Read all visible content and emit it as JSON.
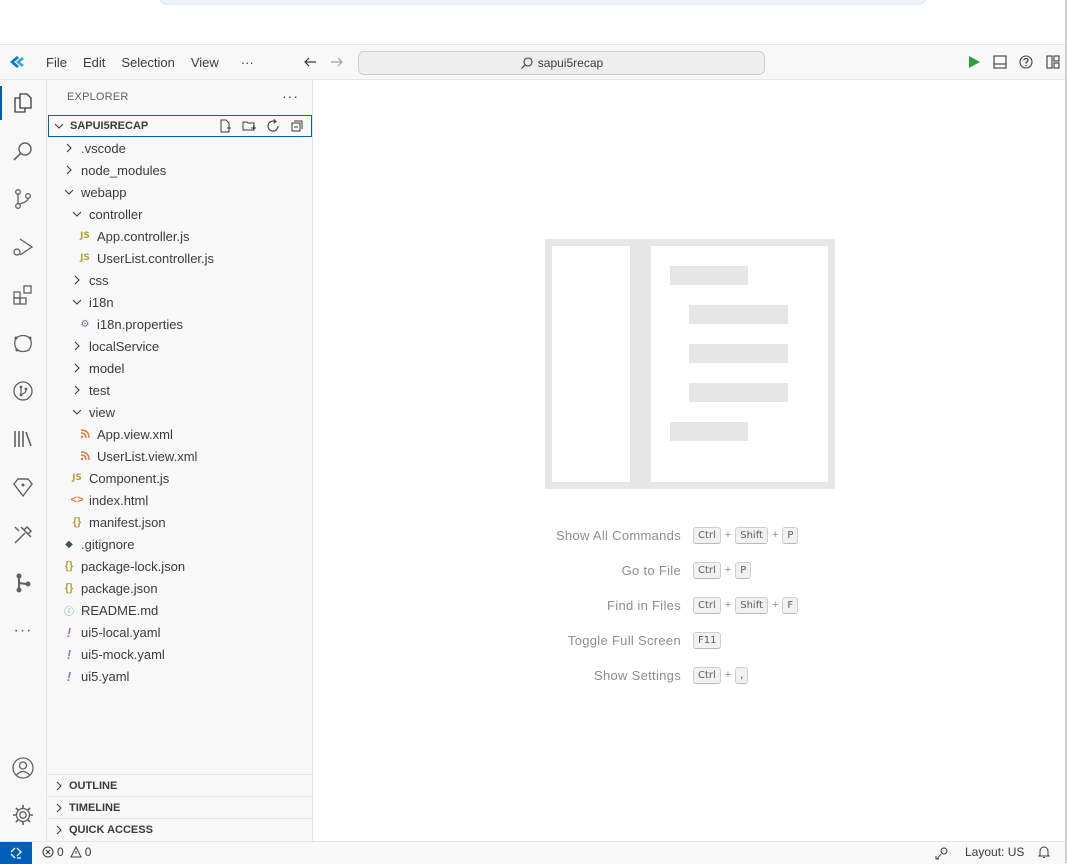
{
  "menu": [
    "File",
    "Edit",
    "Selection",
    "View",
    "···"
  ],
  "command_center": "sapui5recap",
  "explorer": {
    "title": "EXPLORER",
    "more": "···",
    "project": "SAPUI5RECAP"
  },
  "tree": [
    {
      "label": ".vscode",
      "kind": "folder",
      "expanded": false,
      "depth": 1
    },
    {
      "label": "node_modules",
      "kind": "folder",
      "expanded": false,
      "depth": 1
    },
    {
      "label": "webapp",
      "kind": "folder",
      "expanded": true,
      "depth": 1
    },
    {
      "label": "controller",
      "kind": "folder",
      "expanded": true,
      "depth": 2
    },
    {
      "label": "App.controller.js",
      "kind": "js",
      "depth": 3
    },
    {
      "label": "UserList.controller.js",
      "kind": "js",
      "depth": 3
    },
    {
      "label": "css",
      "kind": "folder",
      "expanded": false,
      "depth": 2
    },
    {
      "label": "i18n",
      "kind": "folder",
      "expanded": true,
      "depth": 2
    },
    {
      "label": "i18n.properties",
      "kind": "gear",
      "depth": 3
    },
    {
      "label": "localService",
      "kind": "folder",
      "expanded": false,
      "depth": 2
    },
    {
      "label": "model",
      "kind": "folder",
      "expanded": false,
      "depth": 2
    },
    {
      "label": "test",
      "kind": "folder",
      "expanded": false,
      "depth": 2
    },
    {
      "label": "view",
      "kind": "folder",
      "expanded": true,
      "depth": 2
    },
    {
      "label": "App.view.xml",
      "kind": "xml",
      "depth": 3
    },
    {
      "label": "UserList.view.xml",
      "kind": "xml",
      "depth": 3
    },
    {
      "label": "Component.js",
      "kind": "js",
      "depth": 2
    },
    {
      "label": "index.html",
      "kind": "html",
      "depth": 2
    },
    {
      "label": "manifest.json",
      "kind": "json",
      "depth": 2
    },
    {
      "label": ".gitignore",
      "kind": "git",
      "depth": 1
    },
    {
      "label": "package-lock.json",
      "kind": "json",
      "depth": 1
    },
    {
      "label": "package.json",
      "kind": "json",
      "depth": 1
    },
    {
      "label": "README.md",
      "kind": "md",
      "depth": 1
    },
    {
      "label": "ui5-local.yaml",
      "kind": "yaml",
      "depth": 1
    },
    {
      "label": "ui5-mock.yaml",
      "kind": "yaml",
      "depth": 1
    },
    {
      "label": "ui5.yaml",
      "kind": "yaml",
      "depth": 1
    }
  ],
  "panels": {
    "outline": "OUTLINE",
    "timeline": "TIMELINE",
    "quick_access": "QUICK ACCESS"
  },
  "shortcuts": [
    {
      "label": "Show All Commands",
      "keys": [
        "Ctrl",
        "Shift",
        "P"
      ]
    },
    {
      "label": "Go to File",
      "keys": [
        "Ctrl",
        "P"
      ]
    },
    {
      "label": "Find in Files",
      "keys": [
        "Ctrl",
        "Shift",
        "F"
      ]
    },
    {
      "label": "Toggle Full Screen",
      "keys": [
        "F11"
      ]
    },
    {
      "label": "Show Settings",
      "keys": [
        "Ctrl",
        ","
      ]
    }
  ],
  "status": {
    "errors": "0",
    "warnings": "0",
    "layout": "Layout: US"
  },
  "colors": {
    "accent": "#005fb8",
    "run": "#2ea043"
  }
}
